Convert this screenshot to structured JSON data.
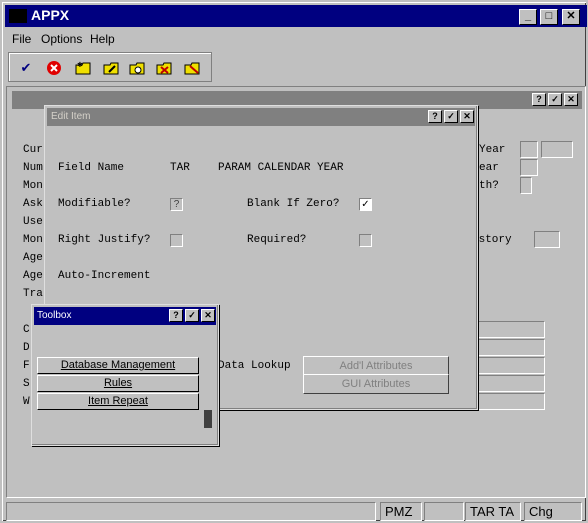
{
  "window": {
    "title": "APPX",
    "logo_text": "APPX"
  },
  "menu": {
    "items": [
      "File",
      "Options",
      "Help"
    ]
  },
  "toolbar": {
    "buttons": [
      "check-icon",
      "cancel-icon",
      "folder-new-icon",
      "folder-edit-icon",
      "folder-search-icon",
      "folder-delete-icon",
      "folder-x-icon"
    ]
  },
  "background_form": {
    "left_labels": [
      "Cur",
      "Num",
      "Mon",
      "Ask",
      "Use",
      "Mon",
      "Age",
      "Age",
      "Tra",
      "C",
      "D",
      "F",
      "S",
      "W"
    ],
    "right_labels": [
      "Year",
      "ear",
      "th?",
      "istory"
    ]
  },
  "edit_item": {
    "title": "Edit Item",
    "field_name_label": "Field Name",
    "field_app": "TAR",
    "field_name_value": "PARAM CALENDAR YEAR",
    "modifiable_label": "Modifiable?",
    "modifiable_value": "?",
    "blank_if_zero_label": "Blank If Zero?",
    "blank_if_zero_checked": "✓",
    "right_justify_label": "Right Justify?",
    "required_label": "Required?",
    "auto_increment_label": "Auto-Increment",
    "data_lookup_label": "Data Lookup",
    "addl_attributes_button": "Add'l Attributes",
    "gui_attributes_button": "GUI Attributes"
  },
  "toolbox": {
    "title": "Toolbox",
    "buttons": [
      "Database Management",
      "Rules",
      "Item Repeat"
    ]
  },
  "status": {
    "cells": [
      "PMZ",
      "TAR TA",
      "Chg"
    ]
  }
}
